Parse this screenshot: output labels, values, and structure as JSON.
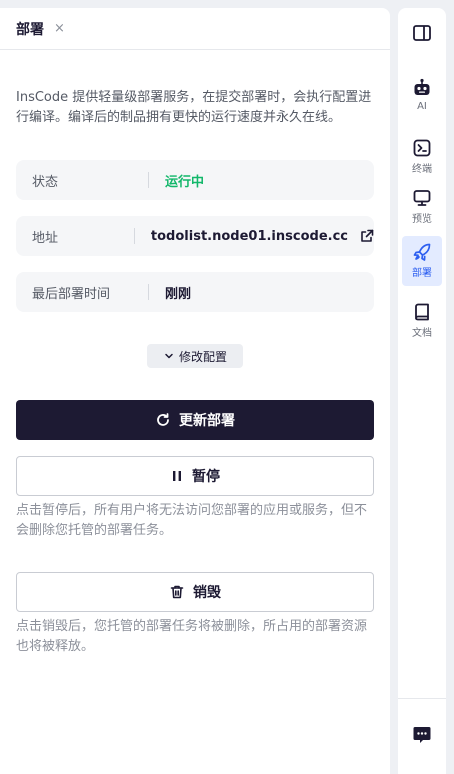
{
  "panel": {
    "tab_title": "部署",
    "close_symbol": "×",
    "description": "InsCode 提供轻量级部署服务，在提交部署时，会执行配置进行编译。编译后的制品拥有更快的运行速度并永久在线。",
    "rows": [
      {
        "label": "状态",
        "value": "运行中"
      },
      {
        "label": "地址",
        "value": "todolist.node01.inscode.cc"
      },
      {
        "label": "最后部署时间",
        "value": "刚刚"
      }
    ],
    "modify_label": "修改配置",
    "redeploy_label": "更新部署",
    "pause_label": "暂停",
    "pause_note": "点击暂停后，所有用户将无法访问您部署的应用或服务，但不会删除您托管的部署任务。",
    "destroy_label": "销毁",
    "destroy_note": "点击销毁后，您托管的部署任务将被删除，所占用的部署资源也将被释放。",
    "status_color": "#12b76a",
    "primary_color": "#1d1a33"
  },
  "rail": {
    "items": [
      {
        "label": "",
        "icon": "sidebar-layout-icon"
      },
      {
        "label": "AI",
        "icon": "robot-icon"
      },
      {
        "label": "终端",
        "icon": "terminal-icon"
      },
      {
        "label": "预览",
        "icon": "monitor-icon"
      },
      {
        "label": "部署",
        "icon": "rocket-icon",
        "active": true
      },
      {
        "label": "文档",
        "icon": "book-icon"
      },
      {
        "label": "",
        "icon": "chat-icon"
      }
    ],
    "active_color": "#2d5ff0"
  }
}
